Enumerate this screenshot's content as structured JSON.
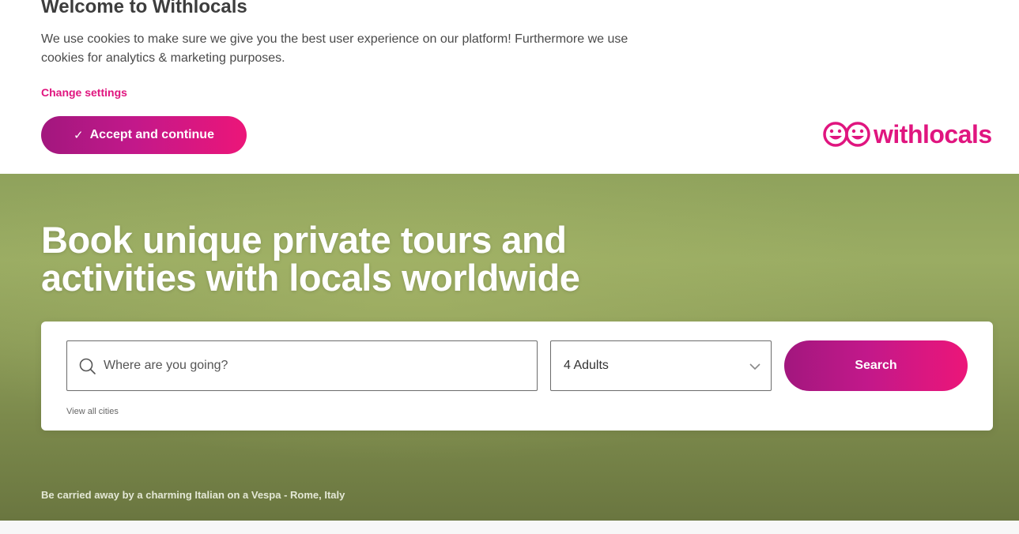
{
  "cookie_banner": {
    "title": "Welcome to Withlocals",
    "text": "We use cookies to make sure we give you the best user experience on our platform! Furthermore we use cookies for analytics & marketing purposes.",
    "change_settings": "Change settings",
    "accept_label": "Accept and continue",
    "accept_icon": "check-icon"
  },
  "logo": {
    "text": "withlocals",
    "icon": "smiley-faces-icon",
    "color": "#e0157f"
  },
  "hero": {
    "headline": "Book unique private tours and activities with locals worldwide",
    "caption": "Be carried away by a charming Italian on a Vespa - Rome, Italy"
  },
  "search": {
    "destination_placeholder": "Where are you going?",
    "adults_value": "4 Adults",
    "button_label": "Search",
    "view_all": "View all cities"
  },
  "colors": {
    "accent_start": "#a2177e",
    "accent_end": "#ec1679",
    "hero_bg": "#8fa25c"
  }
}
